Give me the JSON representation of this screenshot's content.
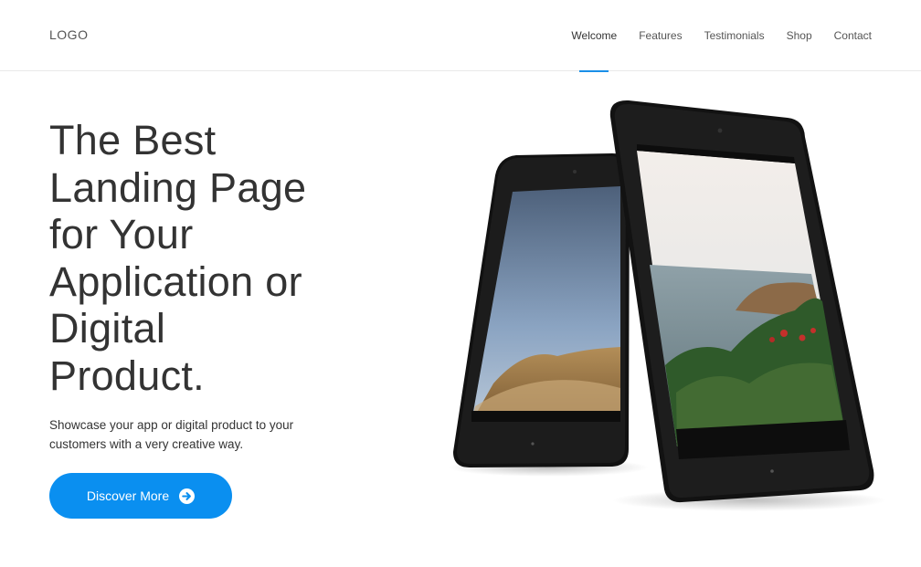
{
  "header": {
    "logo": "LOGO",
    "nav": [
      {
        "label": "Welcome",
        "active": true
      },
      {
        "label": "Features",
        "active": false
      },
      {
        "label": "Testimonials",
        "active": false
      },
      {
        "label": "Shop",
        "active": false
      },
      {
        "label": "Contact",
        "active": false
      }
    ],
    "active_indicator_color": "#1a8fe8"
  },
  "hero": {
    "title_lines": [
      "The Best",
      "Landing Page",
      "for Your",
      "Application or",
      "Digital",
      "Product."
    ],
    "subtitle": "Showcase your app or digital product to your customers with a very creative way.",
    "cta": {
      "label": "Discover More",
      "icon": "arrow-circle-right-icon",
      "color": "#0a8ff0"
    }
  },
  "illustration": {
    "name": "two-tablets-image",
    "back_tablet_screen": "desert-hills-photo",
    "front_tablet_screen": "coastal-shrubs-photo"
  }
}
